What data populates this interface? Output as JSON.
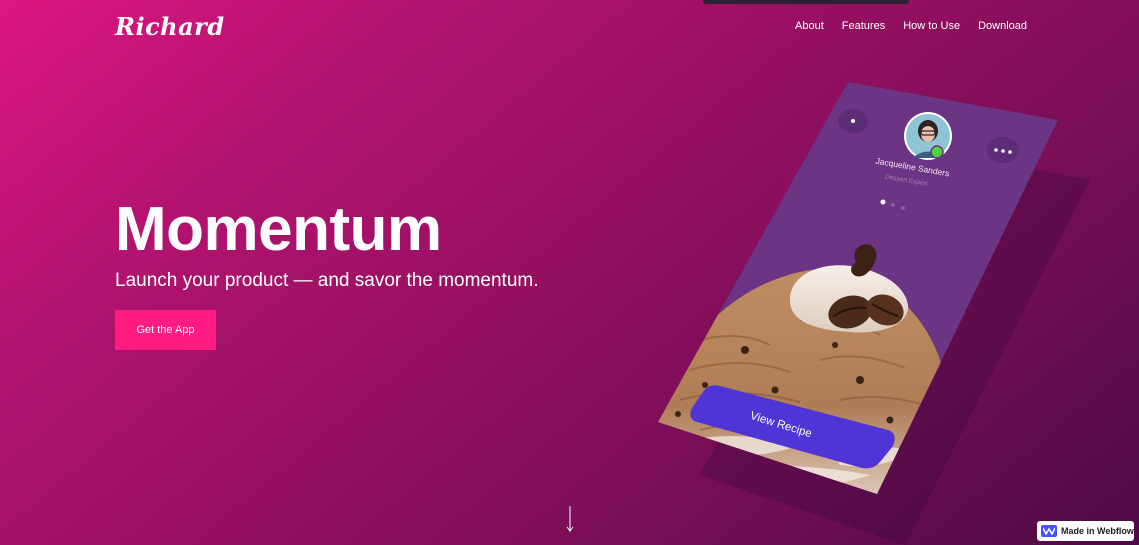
{
  "brand": {
    "logo_text": "Richard"
  },
  "nav": {
    "items": [
      {
        "label": "About"
      },
      {
        "label": "Features"
      },
      {
        "label": "How to Use"
      },
      {
        "label": "Download"
      }
    ]
  },
  "hero": {
    "title": "Momentum",
    "subtitle": "Launch your product — and savor the momentum.",
    "cta_label": "Get the App"
  },
  "phone": {
    "profile_name": "Jacqueline Sanders",
    "profile_role": "Dessert Expert",
    "view_recipe_label": "View Recipe"
  },
  "badge": {
    "label": "Made in Webflow"
  },
  "colors": {
    "accent": "#ff1b82",
    "phone_screen": "#6b3484",
    "recipe_button": "#4f34d6"
  },
  "icons": {
    "scroll": "arrow-down-icon",
    "options": "more-options-icon",
    "back": "dot-icon",
    "online": "online-status-icon"
  }
}
